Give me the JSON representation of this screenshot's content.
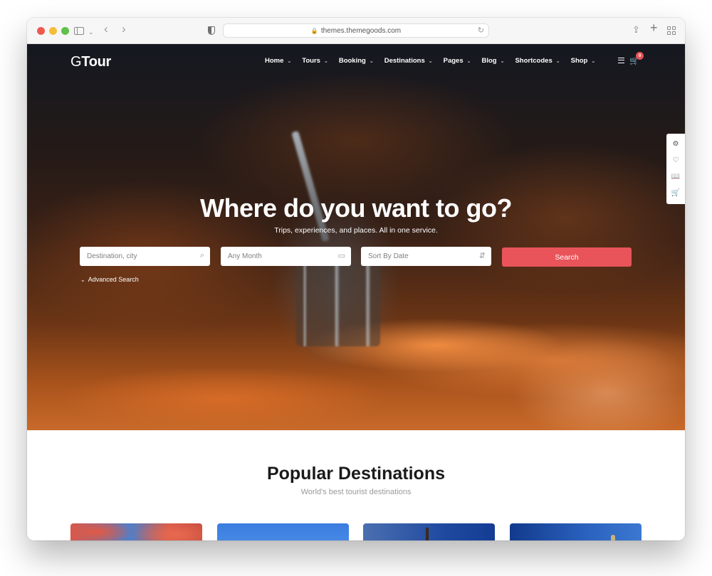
{
  "browser": {
    "url": "themes.themegoods.com",
    "icons": {
      "close": "close-dot",
      "minimize": "minimize-dot",
      "zoom": "zoom-dot",
      "sidebar": "sidebar-icon",
      "back": "‹",
      "forward": "›",
      "privacy": "shield-icon",
      "lock": "🔒",
      "reload": "↻",
      "share": "⇪",
      "new_tab": "+",
      "tab_overview": "grid-icon"
    }
  },
  "site": {
    "logo_g": "G",
    "logo_rest": "Tour",
    "nav": [
      {
        "label": "Home"
      },
      {
        "label": "Tours"
      },
      {
        "label": "Booking"
      },
      {
        "label": "Destinations"
      },
      {
        "label": "Pages"
      },
      {
        "label": "Blog"
      },
      {
        "label": "Shortcodes"
      },
      {
        "label": "Shop"
      }
    ],
    "nav_chevron": "⌄",
    "cart_count": "0",
    "side_panel": [
      "⚙",
      "♡",
      "📖",
      "🛒"
    ]
  },
  "hero": {
    "title": "Where do you want to go?",
    "subtitle": "Trips, experiences, and places. All in one service.",
    "destination_placeholder": "Destination, city",
    "month_value": "Any Month",
    "sort_value": "Sort By Date",
    "search_button": "Search",
    "advanced_search": "Advanced Search",
    "accent_color": "#e9545a"
  },
  "destinations": {
    "title": "Popular Destinations",
    "subtitle": "World's best tourist destinations"
  }
}
